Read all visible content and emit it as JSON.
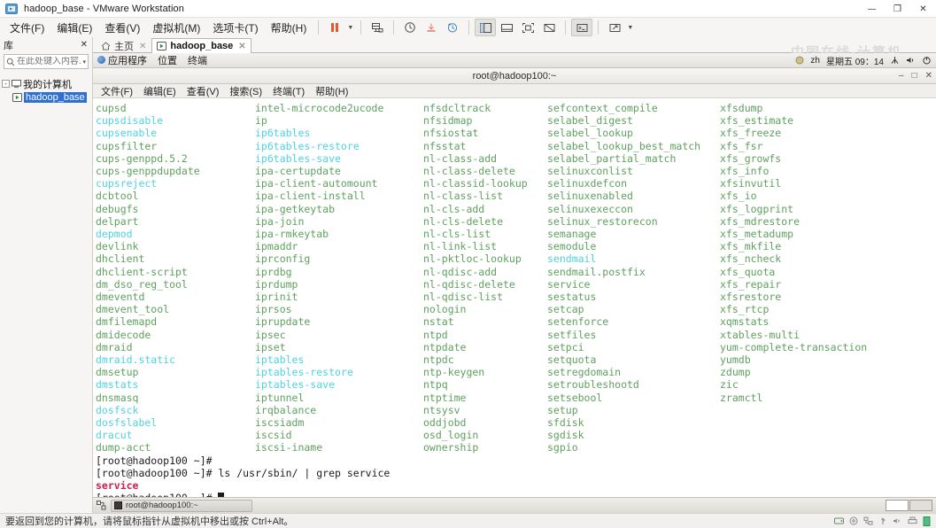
{
  "window": {
    "title": "hadoop_base - VMware Workstation",
    "app_icon": "vmware-icon",
    "minimize": "—",
    "maximize": "❐",
    "close": "✕"
  },
  "menubar": {
    "items": [
      {
        "label": "文件(F)",
        "name": "menu-file"
      },
      {
        "label": "编辑(E)",
        "name": "menu-edit"
      },
      {
        "label": "查看(V)",
        "name": "menu-view"
      },
      {
        "label": "虚拟机(M)",
        "name": "menu-vm"
      },
      {
        "label": "选项卡(T)",
        "name": "menu-tabs"
      },
      {
        "label": "帮助(H)",
        "name": "menu-help"
      }
    ]
  },
  "toolbar": {
    "buttons": [
      {
        "name": "suspend-icon",
        "title": "挂起"
      },
      {
        "name": "dropdown-caret-icon",
        "title": "电源选项"
      },
      {
        "name": "snapshot-manager-icon",
        "title": "快照管理器"
      },
      {
        "name": "take-snapshot-icon",
        "title": "拍摄快照"
      },
      {
        "name": "revert-snapshot-icon",
        "title": "恢复快照"
      },
      {
        "name": "manage-snapshot-icon",
        "title": "管理快照"
      },
      {
        "name": "show-library-icon",
        "title": "显示或隐藏库"
      },
      {
        "name": "show-thumbnail-icon",
        "title": "显示缩略图栏"
      },
      {
        "name": "fullscreen-icon",
        "title": "全屏"
      },
      {
        "name": "unity-icon",
        "title": "Unity 模式"
      },
      {
        "name": "console-icon",
        "title": "控制台视图"
      },
      {
        "name": "stretch-icon",
        "title": "自由拉伸"
      },
      {
        "name": "stretch-caret-icon",
        "title": "拉伸选项"
      }
    ]
  },
  "sidebar": {
    "title": "库",
    "close_label": "✕",
    "search": {
      "placeholder": "在此处键入内容...",
      "value": "",
      "icon": "search-icon",
      "caret": "▾"
    },
    "tree": [
      {
        "label": "我的计算机",
        "name": "tree-item-my-computer",
        "expander": "-",
        "icon": "computer-icon",
        "selected": false
      },
      {
        "label": "hadoop_base",
        "name": "tree-item-hadoop-base",
        "icon": "vm-icon",
        "selected": true
      }
    ]
  },
  "tabs": [
    {
      "label": "主页",
      "name": "tab-home",
      "icon": "home-icon",
      "active": false,
      "close": "✕"
    },
    {
      "label": "hadoop_base",
      "name": "tab-hadoop-base",
      "icon": "vm-icon",
      "active": true,
      "close": "✕"
    }
  ],
  "watermark": "中国在线-计算机",
  "guest": {
    "panel": {
      "left": [
        {
          "label": "应用程序",
          "name": "gnome-applications-menu"
        },
        {
          "label": "位置",
          "name": "gnome-places-menu"
        },
        {
          "label": "终端",
          "name": "gnome-current-app"
        }
      ],
      "right": {
        "indicator_icon": "circle-indicator-icon",
        "input_method": "zh",
        "clock": "星期五 09：14",
        "network_icon": "network-icon",
        "volume_icon": "volume-icon",
        "power_icon": "power-icon"
      }
    },
    "terminal": {
      "title": "root@hadoop100:~",
      "window_buttons": {
        "minimize": "–",
        "maximize": "□",
        "close": "✕"
      },
      "menu": [
        {
          "label": "文件(F)",
          "name": "term-menu-file"
        },
        {
          "label": "编辑(E)",
          "name": "term-menu-edit"
        },
        {
          "label": "查看(V)",
          "name": "term-menu-view"
        },
        {
          "label": "搜索(S)",
          "name": "term-menu-search"
        },
        {
          "label": "终端(T)",
          "name": "term-menu-terminal"
        },
        {
          "label": "帮助(H)",
          "name": "term-menu-help"
        }
      ],
      "colors": {
        "file": "#5fa05f",
        "symlink": "#4fd2e0",
        "match": "#cc1f52"
      },
      "columns": [
        [
          {
            "t": "cupsd",
            "c": "f"
          },
          {
            "t": "cupsdisable",
            "c": "l"
          },
          {
            "t": "cupsenable",
            "c": "l"
          },
          {
            "t": "cupsfilter",
            "c": "f"
          },
          {
            "t": "cups-genppd.5.2",
            "c": "f"
          },
          {
            "t": "cups-genppdupdate",
            "c": "f"
          },
          {
            "t": "cupsreject",
            "c": "l"
          },
          {
            "t": "dcbtool",
            "c": "f"
          },
          {
            "t": "debugfs",
            "c": "f"
          },
          {
            "t": "delpart",
            "c": "f"
          },
          {
            "t": "depmod",
            "c": "l"
          },
          {
            "t": "devlink",
            "c": "f"
          },
          {
            "t": "dhclient",
            "c": "f"
          },
          {
            "t": "dhclient-script",
            "c": "f"
          },
          {
            "t": "dm_dso_reg_tool",
            "c": "f"
          },
          {
            "t": "dmeventd",
            "c": "f"
          },
          {
            "t": "dmevent_tool",
            "c": "f"
          },
          {
            "t": "dmfilemapd",
            "c": "f"
          },
          {
            "t": "dmidecode",
            "c": "f"
          },
          {
            "t": "dmraid",
            "c": "f"
          },
          {
            "t": "dmraid.static",
            "c": "l"
          },
          {
            "t": "dmsetup",
            "c": "f"
          },
          {
            "t": "dmstats",
            "c": "l"
          },
          {
            "t": "dnsmasq",
            "c": "f"
          },
          {
            "t": "dosfsck",
            "c": "l"
          },
          {
            "t": "dosfslabel",
            "c": "l"
          },
          {
            "t": "dracut",
            "c": "l"
          },
          {
            "t": "dump-acct",
            "c": "f"
          }
        ],
        [
          {
            "t": "intel-microcode2ucode",
            "c": "f"
          },
          {
            "t": "ip",
            "c": "f"
          },
          {
            "t": "ip6tables",
            "c": "l"
          },
          {
            "t": "ip6tables-restore",
            "c": "l"
          },
          {
            "t": "ip6tables-save",
            "c": "l"
          },
          {
            "t": "ipa-certupdate",
            "c": "f"
          },
          {
            "t": "ipa-client-automount",
            "c": "f"
          },
          {
            "t": "ipa-client-install",
            "c": "f"
          },
          {
            "t": "ipa-getkeytab",
            "c": "f"
          },
          {
            "t": "ipa-join",
            "c": "f"
          },
          {
            "t": "ipa-rmkeytab",
            "c": "f"
          },
          {
            "t": "ipmaddr",
            "c": "f"
          },
          {
            "t": "iprconfig",
            "c": "f"
          },
          {
            "t": "iprdbg",
            "c": "f"
          },
          {
            "t": "iprdump",
            "c": "f"
          },
          {
            "t": "iprinit",
            "c": "f"
          },
          {
            "t": "iprsos",
            "c": "f"
          },
          {
            "t": "iprupdate",
            "c": "f"
          },
          {
            "t": "ipsec",
            "c": "f"
          },
          {
            "t": "ipset",
            "c": "f"
          },
          {
            "t": "iptables",
            "c": "l"
          },
          {
            "t": "iptables-restore",
            "c": "l"
          },
          {
            "t": "iptables-save",
            "c": "l"
          },
          {
            "t": "iptunnel",
            "c": "f"
          },
          {
            "t": "irqbalance",
            "c": "f"
          },
          {
            "t": "iscsiadm",
            "c": "f"
          },
          {
            "t": "iscsid",
            "c": "f"
          },
          {
            "t": "iscsi-iname",
            "c": "f"
          }
        ],
        [
          {
            "t": "nfsdcltrack",
            "c": "f"
          },
          {
            "t": "nfsidmap",
            "c": "f"
          },
          {
            "t": "nfsiostat",
            "c": "f"
          },
          {
            "t": "nfsstat",
            "c": "f"
          },
          {
            "t": "nl-class-add",
            "c": "f"
          },
          {
            "t": "nl-class-delete",
            "c": "f"
          },
          {
            "t": "nl-classid-lookup",
            "c": "f"
          },
          {
            "t": "nl-class-list",
            "c": "f"
          },
          {
            "t": "nl-cls-add",
            "c": "f"
          },
          {
            "t": "nl-cls-delete",
            "c": "f"
          },
          {
            "t": "nl-cls-list",
            "c": "f"
          },
          {
            "t": "nl-link-list",
            "c": "f"
          },
          {
            "t": "nl-pktloc-lookup",
            "c": "f"
          },
          {
            "t": "nl-qdisc-add",
            "c": "f"
          },
          {
            "t": "nl-qdisc-delete",
            "c": "f"
          },
          {
            "t": "nl-qdisc-list",
            "c": "f"
          },
          {
            "t": "nologin",
            "c": "f"
          },
          {
            "t": "nstat",
            "c": "f"
          },
          {
            "t": "ntpd",
            "c": "f"
          },
          {
            "t": "ntpdate",
            "c": "f"
          },
          {
            "t": "ntpdc",
            "c": "f"
          },
          {
            "t": "ntp-keygen",
            "c": "f"
          },
          {
            "t": "ntpq",
            "c": "f"
          },
          {
            "t": "ntptime",
            "c": "f"
          },
          {
            "t": "ntsysv",
            "c": "f"
          },
          {
            "t": "oddjobd",
            "c": "f"
          },
          {
            "t": "osd_login",
            "c": "f"
          },
          {
            "t": "ownership",
            "c": "f"
          }
        ],
        [
          {
            "t": "sefcontext_compile",
            "c": "f"
          },
          {
            "t": "selabel_digest",
            "c": "f"
          },
          {
            "t": "selabel_lookup",
            "c": "f"
          },
          {
            "t": "selabel_lookup_best_match",
            "c": "f"
          },
          {
            "t": "selabel_partial_match",
            "c": "f"
          },
          {
            "t": "selinuxconlist",
            "c": "f"
          },
          {
            "t": "selinuxdefcon",
            "c": "f"
          },
          {
            "t": "selinuxenabled",
            "c": "f"
          },
          {
            "t": "selinuxexeccon",
            "c": "f"
          },
          {
            "t": "selinux_restorecon",
            "c": "f"
          },
          {
            "t": "semanage",
            "c": "f"
          },
          {
            "t": "semodule",
            "c": "f"
          },
          {
            "t": "sendmail",
            "c": "l"
          },
          {
            "t": "sendmail.postfix",
            "c": "f"
          },
          {
            "t": "service",
            "c": "f"
          },
          {
            "t": "sestatus",
            "c": "f"
          },
          {
            "t": "setcap",
            "c": "f"
          },
          {
            "t": "setenforce",
            "c": "f"
          },
          {
            "t": "setfiles",
            "c": "f"
          },
          {
            "t": "setpci",
            "c": "f"
          },
          {
            "t": "setquota",
            "c": "f"
          },
          {
            "t": "setregdomain",
            "c": "f"
          },
          {
            "t": "setroubleshootd",
            "c": "f"
          },
          {
            "t": "setsebool",
            "c": "f"
          },
          {
            "t": "setup",
            "c": "f"
          },
          {
            "t": "sfdisk",
            "c": "f"
          },
          {
            "t": "sgdisk",
            "c": "f"
          },
          {
            "t": "sgpio",
            "c": "f"
          }
        ],
        [
          {
            "t": "xfsdump",
            "c": "f"
          },
          {
            "t": "xfs_estimate",
            "c": "f"
          },
          {
            "t": "xfs_freeze",
            "c": "f"
          },
          {
            "t": "xfs_fsr",
            "c": "f"
          },
          {
            "t": "xfs_growfs",
            "c": "f"
          },
          {
            "t": "xfs_info",
            "c": "f"
          },
          {
            "t": "xfsinvutil",
            "c": "f"
          },
          {
            "t": "xfs_io",
            "c": "f"
          },
          {
            "t": "xfs_logprint",
            "c": "f"
          },
          {
            "t": "xfs_mdrestore",
            "c": "f"
          },
          {
            "t": "xfs_metadump",
            "c": "f"
          },
          {
            "t": "xfs_mkfile",
            "c": "f"
          },
          {
            "t": "xfs_ncheck",
            "c": "f"
          },
          {
            "t": "xfs_quota",
            "c": "f"
          },
          {
            "t": "xfs_repair",
            "c": "f"
          },
          {
            "t": "xfsrestore",
            "c": "f"
          },
          {
            "t": "xfs_rtcp",
            "c": "f"
          },
          {
            "t": "xqmstats",
            "c": "f"
          },
          {
            "t": "xtables-multi",
            "c": "f"
          },
          {
            "t": "yum-complete-transaction",
            "c": "f"
          },
          {
            "t": "yumdb",
            "c": "f"
          },
          {
            "t": "zdump",
            "c": "f"
          },
          {
            "t": "zic",
            "c": "f"
          },
          {
            "t": "zramctl",
            "c": "f"
          }
        ]
      ],
      "prompt_lines": [
        {
          "prompt": "[root@hadoop100 ~]# ",
          "cmd": "",
          "name": "terminal-line-prompt-1"
        },
        {
          "prompt": "[root@hadoop100 ~]# ",
          "cmd": "ls /usr/sbin/ | grep service",
          "name": "terminal-line-command"
        },
        {
          "prompt": "",
          "cmd": "service",
          "match": true,
          "name": "terminal-line-output-match"
        },
        {
          "prompt": "[root@hadoop100 ~]# ",
          "cmd": "",
          "cursor": true,
          "name": "terminal-line-prompt-2"
        }
      ]
    },
    "taskbar": {
      "window_button": {
        "label": "root@hadoop100:~",
        "name": "taskbar-window-terminal",
        "icon": "terminal-icon"
      },
      "show_desktop_icon": "show-desktop-icon",
      "workspaces": [
        {
          "name": "workspace-1",
          "active": true
        },
        {
          "name": "workspace-2",
          "active": false
        }
      ]
    }
  },
  "statusbar": {
    "message": "要返回到您的计算机，请将鼠标指针从虚拟机中移出或按 Ctrl+Alt。",
    "icons": [
      {
        "name": "hard-disk-icon"
      },
      {
        "name": "cd-dvd-icon"
      },
      {
        "name": "network-adapter-icon"
      },
      {
        "name": "usb-icon"
      },
      {
        "name": "sound-card-icon"
      },
      {
        "name": "printer-icon"
      },
      {
        "name": "display-icon"
      }
    ]
  }
}
